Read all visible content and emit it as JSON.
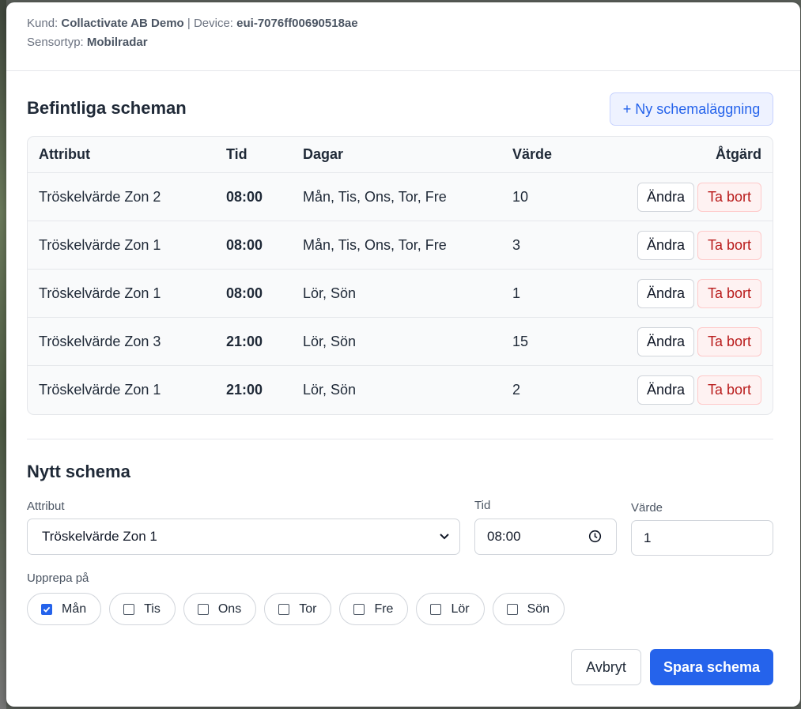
{
  "header": {
    "customer_label": "Kund:",
    "customer_value": "Collactivate AB Demo",
    "separator": "|",
    "device_label": "Device:",
    "device_value": "eui-7076ff00690518ae",
    "sensor_label": "Sensortyp:",
    "sensor_value": "Mobilradar"
  },
  "existing": {
    "title": "Befintliga scheman",
    "new_button": "+ Ny schemaläggning",
    "columns": [
      "Attribut",
      "Tid",
      "Dagar",
      "Värde",
      "Åtgärd"
    ],
    "rows": [
      {
        "attr": "Tröskelvärde Zon 2",
        "time": "08:00",
        "days": "Mån, Tis, Ons, Tor, Fre",
        "value": "10"
      },
      {
        "attr": "Tröskelvärde Zon 1",
        "time": "08:00",
        "days": "Mån, Tis, Ons, Tor, Fre",
        "value": "3"
      },
      {
        "attr": "Tröskelvärde Zon 1",
        "time": "08:00",
        "days": "Lör, Sön",
        "value": "1"
      },
      {
        "attr": "Tröskelvärde Zon 3",
        "time": "21:00",
        "days": "Lör, Sön",
        "value": "15"
      },
      {
        "attr": "Tröskelvärde Zon 1",
        "time": "21:00",
        "days": "Lör, Sön",
        "value": "2"
      }
    ],
    "edit_label": "Ändra",
    "delete_label": "Ta bort"
  },
  "form": {
    "title": "Nytt schema",
    "attr_label": "Attribut",
    "attr_value": "Tröskelvärde Zon 1",
    "time_label": "Tid",
    "time_value": "08:00",
    "value_label": "Värde",
    "value_value": "1",
    "repeat_label": "Upprepa på",
    "days": [
      {
        "label": "Mån",
        "checked": true
      },
      {
        "label": "Tis",
        "checked": false
      },
      {
        "label": "Ons",
        "checked": false
      },
      {
        "label": "Tor",
        "checked": false
      },
      {
        "label": "Fre",
        "checked": false
      },
      {
        "label": "Lör",
        "checked": false
      },
      {
        "label": "Sön",
        "checked": false
      }
    ],
    "cancel_label": "Avbryt",
    "save_label": "Spara schema"
  },
  "colors": {
    "primary": "#2563eb",
    "danger_text": "#b91c1c",
    "danger_bg": "#fef2f2"
  }
}
